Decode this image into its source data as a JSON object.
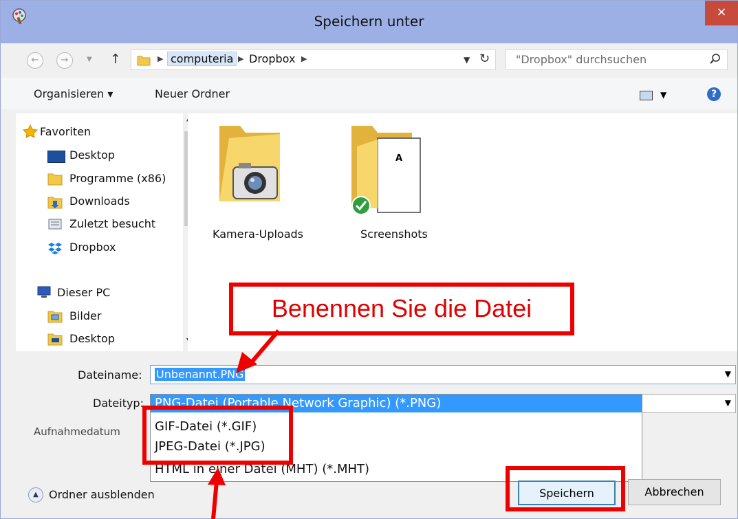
{
  "window": {
    "title": "Speichern unter",
    "close_label": "×"
  },
  "navigation": {
    "breadcrumbs": [
      "computeria",
      "Dropbox"
    ],
    "search_placeholder": "\"Dropbox\" durchsuchen"
  },
  "toolbar": {
    "organize_label": "Organisieren ▾",
    "new_folder_label": "Neuer Ordner"
  },
  "sidebar": {
    "favorites_label": "Favoriten",
    "items": [
      {
        "label": "Desktop",
        "icon": "desktop-icon"
      },
      {
        "label": "Programme (x86)",
        "icon": "folder-icon"
      },
      {
        "label": "Downloads",
        "icon": "downloads-folder-icon"
      },
      {
        "label": "Zuletzt besucht",
        "icon": "recent-places-icon"
      },
      {
        "label": "Dropbox",
        "icon": "dropbox-icon"
      }
    ],
    "pc_label": "Dieser PC",
    "pc_items": [
      {
        "label": "Bilder",
        "icon": "pictures-folder-icon"
      },
      {
        "label": "Desktop",
        "icon": "desktop-folder-icon"
      }
    ]
  },
  "files": [
    {
      "label": "Kamera-Uploads",
      "icon": "camera-folder-icon"
    },
    {
      "label": "Screenshots",
      "icon": "synced-folder-icon",
      "page_letter": "A"
    }
  ],
  "form": {
    "filename_label": "Dateiname:",
    "filename_value": "Unbenannt.PNG",
    "filetype_label": "Dateityp:",
    "capture_date_label": "Aufnahmedatum",
    "filetype_options": [
      "PNG-Datei (Portable Network Graphic) (*.PNG)",
      "GIF-Datei (*.GIF)",
      "JPEG-Datei (*.JPG)",
      "HTML in einer Datei (MHT) (*.MHT)"
    ],
    "selected_option_index": 0
  },
  "footer": {
    "hide_folders_label": "Ordner ausblenden",
    "save_label": "Speichern",
    "cancel_label": "Abbrechen"
  },
  "annotation": {
    "callout_text": "Benennen Sie die Datei",
    "color": "#ee0000"
  },
  "colors": {
    "titlebar": "#9db0e6",
    "close_button": "#c74a3d",
    "selection": "#3399ff",
    "folder_yellow": "#f2c84b"
  }
}
